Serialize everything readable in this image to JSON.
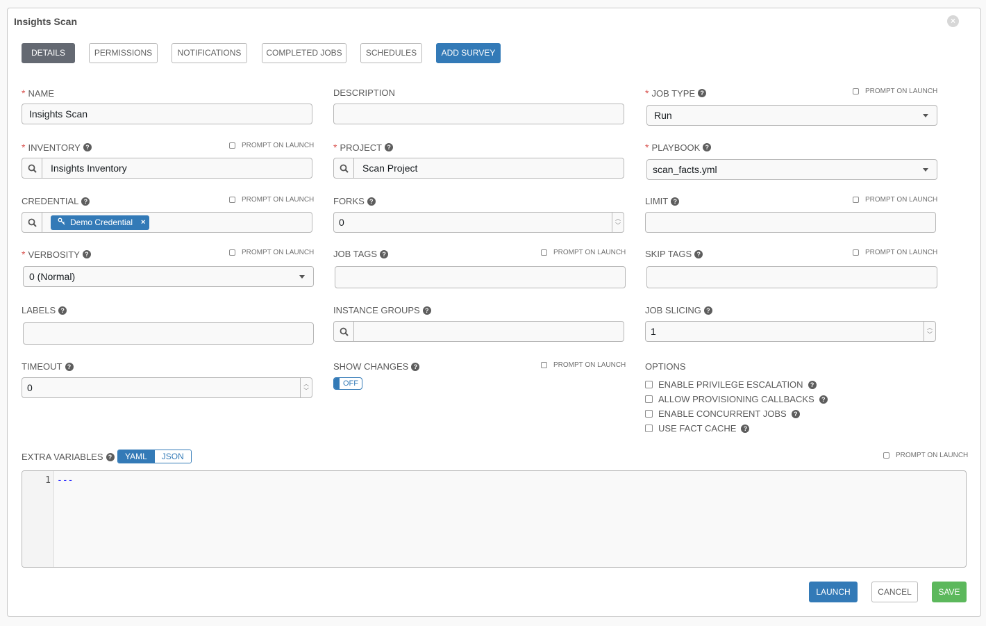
{
  "window": {
    "title": "Insights Scan",
    "close_icon": "times-circle-icon"
  },
  "tabs": [
    {
      "label": "DETAILS",
      "state": "active"
    },
    {
      "label": "PERMISSIONS",
      "state": "default"
    },
    {
      "label": "NOTIFICATIONS",
      "state": "default"
    },
    {
      "label": "COMPLETED JOBS",
      "state": "default"
    },
    {
      "label": "SCHEDULES",
      "state": "default"
    },
    {
      "label": "ADD SURVEY",
      "state": "primary"
    }
  ],
  "prompt_on_launch_label": "PROMPT ON LAUNCH",
  "required_marker": "*",
  "help_glyph": "?",
  "fields": {
    "name": {
      "label": "NAME",
      "value": "Insights Scan",
      "required": true
    },
    "description": {
      "label": "DESCRIPTION",
      "value": ""
    },
    "job_type": {
      "label": "JOB TYPE",
      "value": "Run",
      "required": true
    },
    "inventory": {
      "label": "INVENTORY",
      "value": "Insights Inventory",
      "required": true
    },
    "project": {
      "label": "PROJECT",
      "value": "Scan Project",
      "required": true
    },
    "playbook": {
      "label": "PLAYBOOK",
      "value": "scan_facts.yml",
      "required": true
    },
    "credential": {
      "label": "CREDENTIAL",
      "chip": "Demo Credential",
      "chip_icon": "key-icon",
      "remove_glyph": "×"
    },
    "forks": {
      "label": "FORKS",
      "value": "0"
    },
    "limit": {
      "label": "LIMIT",
      "value": ""
    },
    "verbosity": {
      "label": "VERBOSITY",
      "value": "0 (Normal)",
      "required": true
    },
    "job_tags": {
      "label": "JOB TAGS",
      "value": ""
    },
    "skip_tags": {
      "label": "SKIP TAGS",
      "value": ""
    },
    "labels": {
      "label": "LABELS",
      "value": ""
    },
    "instance_groups": {
      "label": "INSTANCE GROUPS",
      "value": ""
    },
    "job_slicing": {
      "label": "JOB SLICING",
      "value": "1"
    },
    "timeout": {
      "label": "TIMEOUT",
      "value": "0"
    },
    "show_changes": {
      "label": "SHOW CHANGES",
      "toggle": "OFF"
    }
  },
  "options": {
    "label": "OPTIONS",
    "items": [
      {
        "label": "ENABLE PRIVILEGE ESCALATION",
        "checked": false
      },
      {
        "label": "ALLOW PROVISIONING CALLBACKS",
        "checked": false
      },
      {
        "label": "ENABLE CONCURRENT JOBS",
        "checked": false
      },
      {
        "label": "USE FACT CACHE",
        "checked": false
      }
    ]
  },
  "extra_vars": {
    "label": "EXTRA VARIABLES",
    "modes": [
      "YAML",
      "JSON"
    ],
    "active_mode": "YAML",
    "line_number": "1",
    "content": "---"
  },
  "actions": {
    "launch": "LAUNCH",
    "cancel": "CANCEL",
    "save": "SAVE"
  },
  "colors": {
    "primary": "#337ab7",
    "success": "#5cb85c",
    "active_tab": "#646972",
    "required": "#d9534f"
  }
}
